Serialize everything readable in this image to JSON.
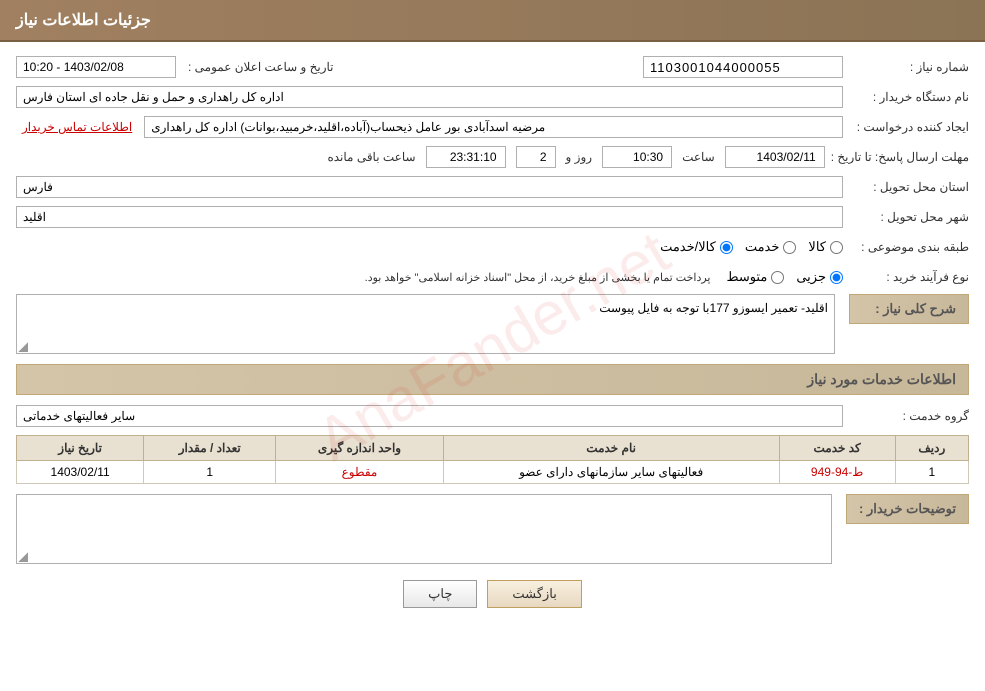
{
  "header": {
    "title": "جزئیات اطلاعات نیاز"
  },
  "fields": {
    "need_number_label": "شماره نیاز :",
    "need_number_value": "1103001044000055",
    "buyer_org_label": "نام دستگاه خریدار :",
    "buyer_org_value": "اداره کل راهداری و حمل و نقل جاده ای استان فارس",
    "creator_label": "ایجاد کننده درخواست :",
    "creator_value": "مرضیه اسدآبادی بور عامل ذیحساب(آباده،اقلید،خرمبید،بوانات) اداره کل راهداری",
    "creator_link": "اطلاعات تماس خریدار",
    "deadline_label": "مهلت ارسال پاسخ: تا تاریخ :",
    "deadline_date": "1403/02/11",
    "deadline_time_label": "ساعت",
    "deadline_time": "10:30",
    "deadline_days_label": "روز و",
    "deadline_days": "2",
    "deadline_remaining_label": "ساعت باقی مانده",
    "deadline_remaining": "23:31:10",
    "announce_label": "تاریخ و ساعت اعلان عمومی :",
    "announce_value": "1403/02/08 - 10:20",
    "province_label": "استان محل تحویل :",
    "province_value": "فارس",
    "city_label": "شهر محل تحویل :",
    "city_value": "اقلید",
    "category_label": "طبقه بندی موضوعی :",
    "category_options": [
      "کالا",
      "خدمت",
      "کالا/خدمت"
    ],
    "category_selected": "کالا",
    "purchase_type_label": "نوع فرآیند خرید :",
    "purchase_type_options": [
      "جزیی",
      "متوسط"
    ],
    "purchase_type_selected": "جزیی",
    "purchase_type_note": "پرداخت تمام یا بخشی از مبلغ خرید، از محل \"اسناد خزانه اسلامی\" خواهد بود.",
    "need_desc_label": "شرح کلی نیاز :",
    "need_desc_value": "اقلید- تعمیر ایسوزو 177با توجه به فایل پیوست",
    "services_section_title": "اطلاعات خدمات مورد نیاز",
    "service_group_label": "گروه خدمت :",
    "service_group_value": "سایر فعالیتهای خدماتی",
    "table": {
      "headers": [
        "ردیف",
        "کد خدمت",
        "نام خدمت",
        "واحد اندازه گیری",
        "تعداد / مقدار",
        "تاریخ نیاز"
      ],
      "rows": [
        {
          "row": "1",
          "code": "ط-94-949",
          "name": "فعالیتهای سایر سازمانهای دارای عضو",
          "unit": "مقطوع",
          "qty": "1",
          "date": "1403/02/11"
        }
      ]
    },
    "buyer_desc_label": "توضیحات خریدار :",
    "btn_print": "چاپ",
    "btn_back": "بازگشت"
  }
}
